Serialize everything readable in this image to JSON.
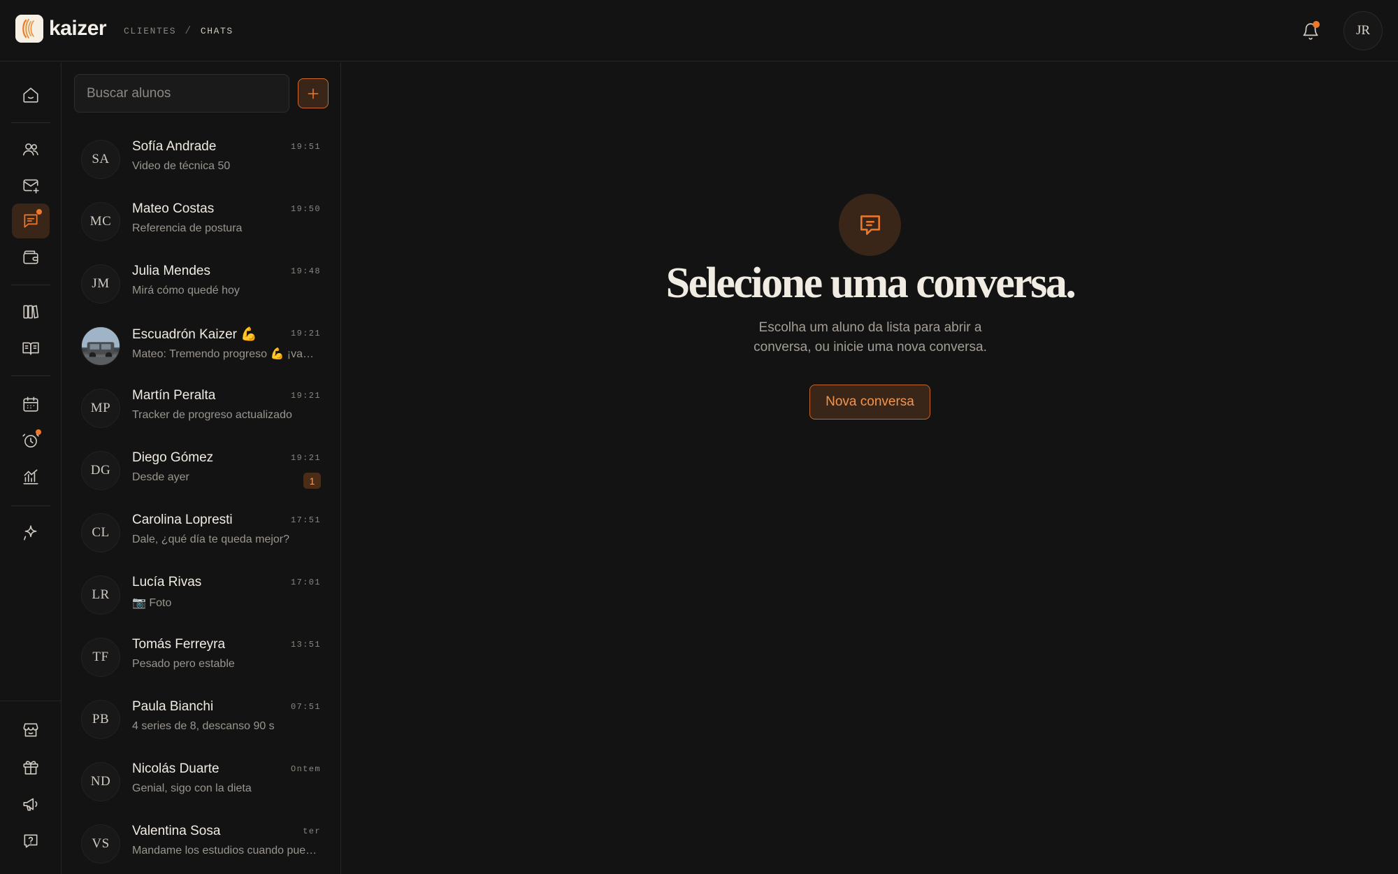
{
  "brand": {
    "name": "kaizer",
    "accent": "#f0782a"
  },
  "breadcrumb": {
    "parent": "CLIENTES",
    "separator": "/",
    "current": "CHATS"
  },
  "header": {
    "user_initials": "JR",
    "notifications_unread": true
  },
  "rail": {
    "items": [
      {
        "icon": "home-icon",
        "active": false,
        "dot": false
      },
      {
        "icon": "users-icon",
        "active": false,
        "dot": false
      },
      {
        "icon": "mail-plus-icon",
        "active": false,
        "dot": false
      },
      {
        "icon": "chat-icon",
        "active": true,
        "dot": true
      },
      {
        "icon": "wallet-icon",
        "active": false,
        "dot": false
      },
      {
        "icon": "library-icon",
        "active": false,
        "dot": false
      },
      {
        "icon": "book-open-icon",
        "active": false,
        "dot": false
      },
      {
        "icon": "calendar-icon",
        "active": false,
        "dot": false
      },
      {
        "icon": "alarm-clock-icon",
        "active": false,
        "dot": true
      },
      {
        "icon": "chart-line-icon",
        "active": false,
        "dot": false
      },
      {
        "icon": "sparkle-icon",
        "active": false,
        "dot": false
      },
      {
        "icon": "store-icon",
        "active": false,
        "dot": false
      },
      {
        "icon": "gift-icon",
        "active": false,
        "dot": false
      },
      {
        "icon": "megaphone-icon",
        "active": false,
        "dot": false
      },
      {
        "icon": "help-icon",
        "active": false,
        "dot": false
      }
    ]
  },
  "search": {
    "placeholder": "Buscar alunos",
    "value": ""
  },
  "chats": [
    {
      "initials": "SA",
      "name": "Sofía Andrade",
      "preview": "Video de técnica 50",
      "time": "19:51"
    },
    {
      "initials": "MC",
      "name": "Mateo Costas",
      "preview": "Referencia de postura",
      "time": "19:50"
    },
    {
      "initials": "JM",
      "name": "Julia Mendes",
      "preview": "Mirá cómo quedé hoy",
      "time": "19:48"
    },
    {
      "initials": "",
      "name": "Escuadrón Kaizer 💪",
      "preview": "Mateo: Tremendo progreso 💪 ¡vamos equipo!",
      "time": "19:21",
      "photo": true
    },
    {
      "initials": "MP",
      "name": "Martín Peralta",
      "preview": "Tracker de progreso actualizado",
      "time": "19:21"
    },
    {
      "initials": "DG",
      "name": "Diego Gómez",
      "preview": "Desde ayer",
      "time": "19:21",
      "badge": "1"
    },
    {
      "initials": "CL",
      "name": "Carolina Lopresti",
      "preview": "Dale, ¿qué día te queda mejor?",
      "time": "17:51"
    },
    {
      "initials": "LR",
      "name": "Lucía Rivas",
      "preview": "📷 Foto",
      "time": "17:01"
    },
    {
      "initials": "TF",
      "name": "Tomás Ferreyra",
      "preview": "Pesado pero estable",
      "time": "13:51"
    },
    {
      "initials": "PB",
      "name": "Paula Bianchi",
      "preview": "4 series de 8, descanso 90 s",
      "time": "07:51"
    },
    {
      "initials": "ND",
      "name": "Nicolás Duarte",
      "preview": "Genial, sigo con la dieta",
      "time": "Ontem"
    },
    {
      "initials": "VS",
      "name": "Valentina Sosa",
      "preview": "Mandame los estudios cuando puedas",
      "time": "ter"
    }
  ],
  "empty_state": {
    "title": "Selecione uma conversa.",
    "description": "Escolha um aluno da lista para abrir a conversa, ou inicie uma nova conversa.",
    "button": "Nova conversa"
  }
}
